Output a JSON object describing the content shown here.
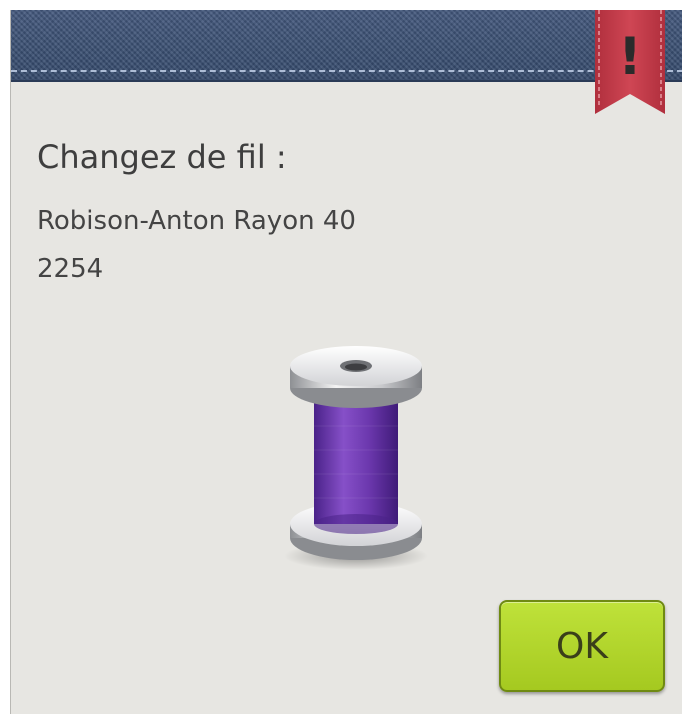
{
  "dialog": {
    "title": "Changez de fil :",
    "thread_name": "Robison-Anton Rayon 40",
    "thread_number": "2254",
    "ok_label": "OK",
    "alert_symbol": "!"
  },
  "icons": {
    "alert": "warning-ribbon-icon",
    "spool": "thread-spool-icon"
  },
  "colors": {
    "header": "#3b4f73",
    "ribbon": "#c63b49",
    "thread": "#7440b4",
    "ok_button": "#b2d52b",
    "background": "#e7e6e2"
  }
}
